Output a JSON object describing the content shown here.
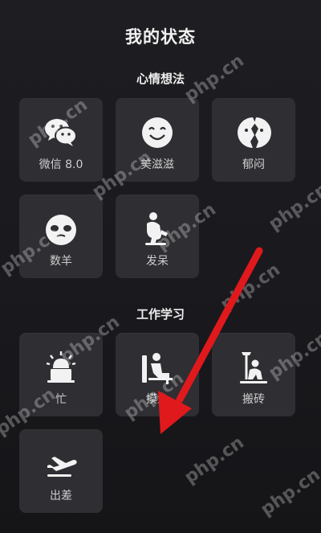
{
  "page_title": "我的状态",
  "sections": [
    {
      "title": "心情想法",
      "items": [
        {
          "label": "微信 8.0",
          "icon": "wechat-icon"
        },
        {
          "label": "美滋滋",
          "icon": "smile-face-icon"
        },
        {
          "label": "郁闷",
          "icon": "broken-face-icon"
        },
        {
          "label": "数羊",
          "icon": "sheep-face-icon"
        },
        {
          "label": "发呆",
          "icon": "daze-person-icon"
        }
      ]
    },
    {
      "title": "工作学习",
      "items": [
        {
          "label": "忙",
          "icon": "alarm-laptop-icon"
        },
        {
          "label": "摸鱼",
          "icon": "relax-person-icon"
        },
        {
          "label": "搬砖",
          "icon": "worker-icon"
        },
        {
          "label": "出差",
          "icon": "airplane-icon"
        }
      ]
    }
  ],
  "watermark": "php.cn",
  "colors": {
    "background": "#1b1b1f",
    "tile": "#2e2e33",
    "arrow": "#e0191c"
  }
}
